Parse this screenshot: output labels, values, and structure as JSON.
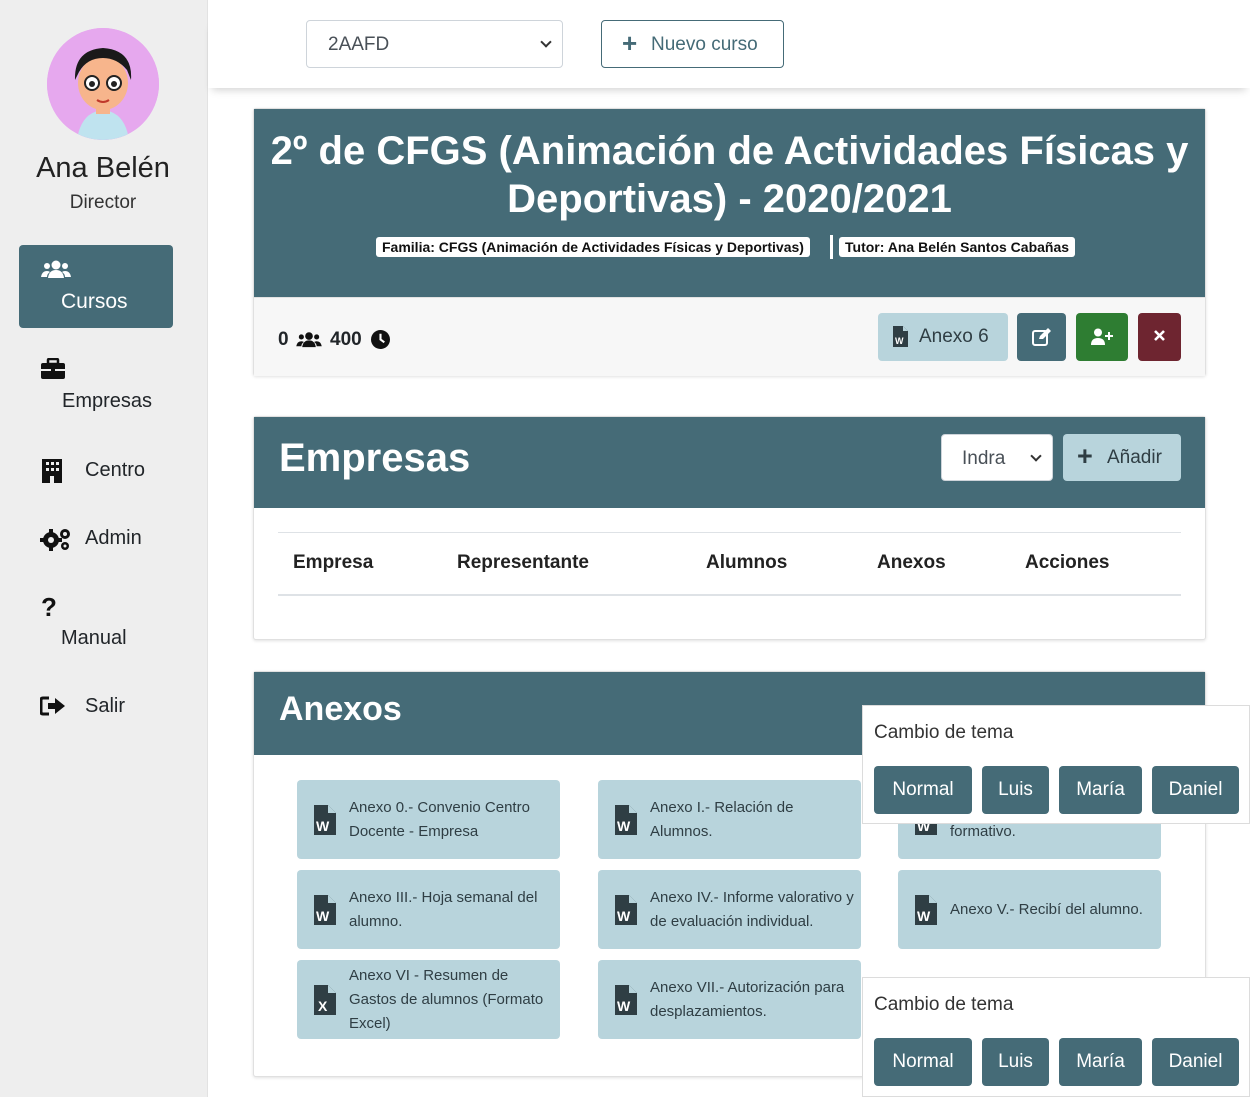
{
  "user": {
    "name": "Ana Belén",
    "role": "Director"
  },
  "sidebar": {
    "items": [
      {
        "label": "Cursos",
        "icon": "users-icon",
        "active": true
      },
      {
        "label": "Empresas",
        "icon": "briefcase-icon"
      },
      {
        "label": "Centro",
        "icon": "building-icon"
      },
      {
        "label": "Admin",
        "icon": "gears-icon"
      },
      {
        "label": "Manual",
        "icon": "question-icon"
      },
      {
        "label": "Salir",
        "icon": "sign-out-icon"
      }
    ]
  },
  "topbar": {
    "course_select": "2AAFD",
    "new_course": "Nuevo curso"
  },
  "course": {
    "title_line1": "2º de CFGS (Animación de Actividades Físicas y",
    "title_line2": "Deportivas) - 2020/2021",
    "familia": "Familia: CFGS (Animación de Actividades Físicas y Deportivas)",
    "tutor": "Tutor: Ana Belén Santos Cabañas",
    "students": "0",
    "hours": "400",
    "anexo_button": "Anexo 6"
  },
  "empresas": {
    "title": "Empresas",
    "select": "Indra",
    "add_button": "Añadir",
    "columns": [
      "Empresa",
      "Representante",
      "Alumnos",
      "Anexos",
      "Acciones"
    ]
  },
  "anexos": {
    "title": "Anexos",
    "items": [
      {
        "label": "Anexo 0.- Convenio Centro Docente - Empresa",
        "icon": "word-file-icon"
      },
      {
        "label": "Anexo I.- Relación de Alumnos.",
        "icon": "word-file-icon"
      },
      {
        "label": "formativo.",
        "icon": "word-file-icon"
      },
      {
        "label": "Anexo III.- Hoja semanal del alumno.",
        "icon": "word-file-icon"
      },
      {
        "label": "Anexo IV.- Informe valorativo y de evaluación individual.",
        "icon": "word-file-icon"
      },
      {
        "label": "Anexo V.- Recibí del alumno.",
        "icon": "word-file-icon"
      },
      {
        "label": "Anexo VI - Resumen de Gastos de alumnos (Formato Excel)",
        "icon": "excel-file-icon"
      },
      {
        "label": "Anexo VII.- Autorización para desplazamientos.",
        "icon": "word-file-icon"
      }
    ]
  },
  "theme_panels": [
    {
      "title": "Cambio de tema",
      "buttons": [
        "Normal",
        "Luis",
        "María",
        "Daniel"
      ]
    },
    {
      "title": "Cambio de tema",
      "buttons": [
        "Normal",
        "Luis",
        "María",
        "Daniel"
      ]
    }
  ],
  "colors": {
    "primary": "#456b77",
    "light": "#b8d4dc",
    "success": "#2e7d32",
    "danger": "#6e2530",
    "sidebar_bg": "#eeeeee"
  }
}
